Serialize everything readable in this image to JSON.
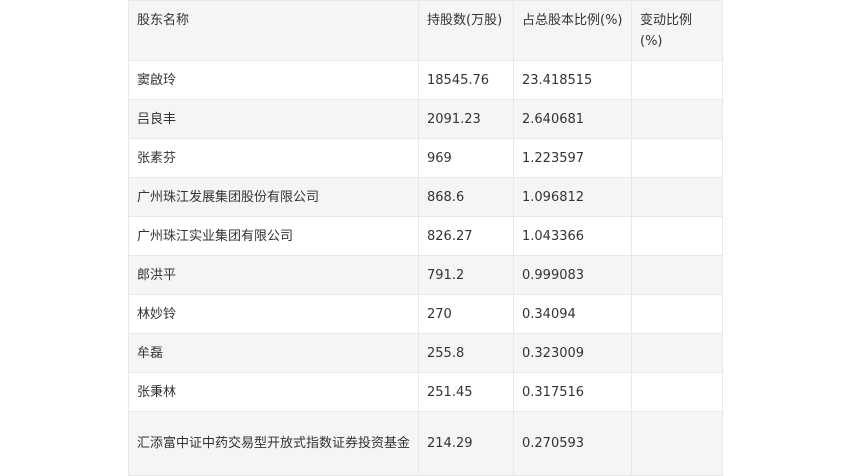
{
  "table": {
    "headers": [
      "股东名称",
      "持股数(万股)",
      "占总股本比例(%)",
      "变动比例(%)"
    ],
    "rows": [
      [
        "窦啟玲",
        "18545.76",
        "23.418515",
        ""
      ],
      [
        "吕良丰",
        "2091.23",
        "2.640681",
        ""
      ],
      [
        "张素芬",
        "969",
        "1.223597",
        ""
      ],
      [
        "广州珠江发展集团股份有限公司",
        "868.6",
        "1.096812",
        ""
      ],
      [
        "广州珠江实业集团有限公司",
        "826.27",
        "1.043366",
        ""
      ],
      [
        "郎洪平",
        "791.2",
        "0.999083",
        ""
      ],
      [
        "林妙铃",
        "270",
        "0.34094",
        ""
      ],
      [
        "牟磊",
        "255.8",
        "0.323009",
        ""
      ],
      [
        "张秉林",
        "251.45",
        "0.317516",
        ""
      ],
      [
        "汇添富中证中药交易型开放式指数证券投资基金",
        "214.29",
        "0.270593",
        ""
      ]
    ]
  }
}
